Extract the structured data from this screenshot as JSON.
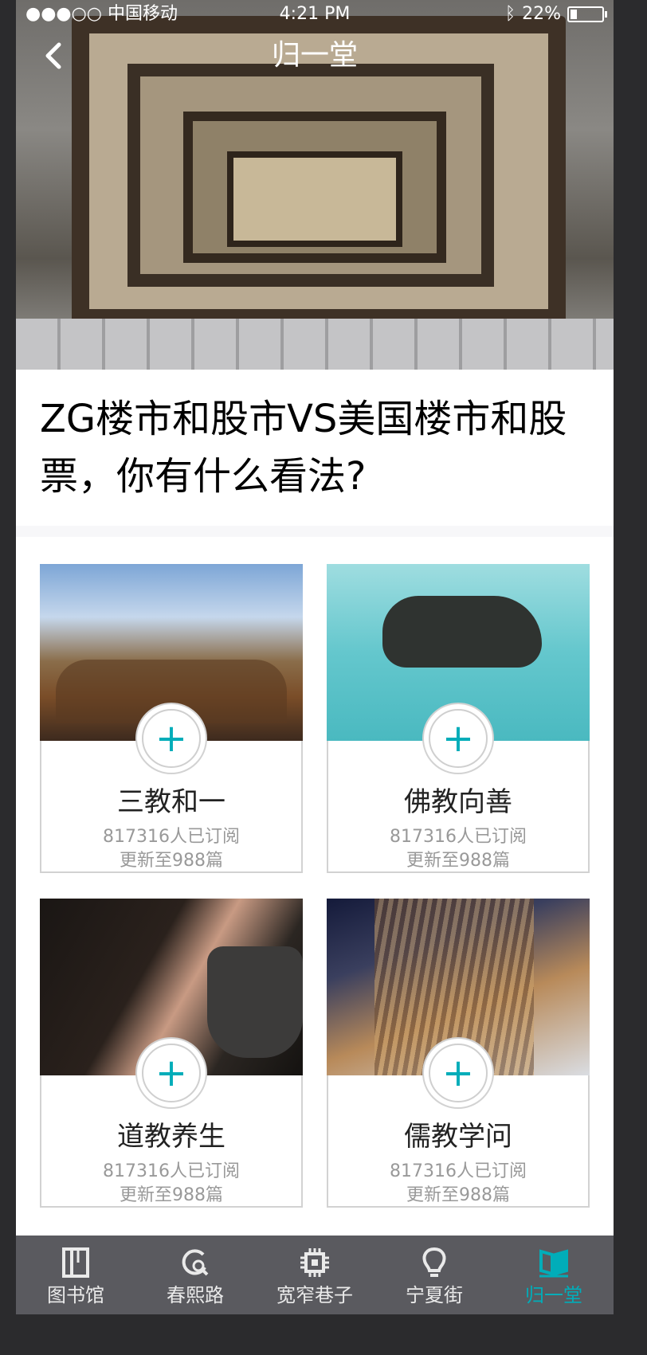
{
  "status_bar": {
    "carrier": "●●●○○ 中国移动",
    "time": "4:21 PM",
    "battery": "22%"
  },
  "nav": {
    "title": "归一堂",
    "back_icon": "chevron-left-icon"
  },
  "headline": "ZG楼市和股市VS美国楼市和股票，你有什么看法?",
  "cards": [
    {
      "title": "三教和一",
      "subscribers": "817316人已订阅",
      "updates": "更新至988篇",
      "add_icon": "plus-icon"
    },
    {
      "title": "佛教向善",
      "subscribers": "817316人已订阅",
      "updates": "更新至988篇",
      "add_icon": "plus-icon"
    },
    {
      "title": "道教养生",
      "subscribers": "817316人已订阅",
      "updates": "更新至988篇",
      "add_icon": "plus-icon"
    },
    {
      "title": "儒教学问",
      "subscribers": "817316人已订阅",
      "updates": "更新至988篇",
      "add_icon": "plus-icon"
    }
  ],
  "tab_bar": {
    "items": [
      {
        "label": "图书馆",
        "icon": "library-icon"
      },
      {
        "label": "春熙路",
        "icon": "refresh-search-icon"
      },
      {
        "label": "宽窄巷子",
        "icon": "chip-icon"
      },
      {
        "label": "宁夏街",
        "icon": "lightbulb-icon"
      },
      {
        "label": "归一堂",
        "icon": "open-book-icon"
      }
    ],
    "active_index": 4
  },
  "colors": {
    "accent": "#01adb9",
    "headline": "#000000",
    "separator": "#f7f7f9",
    "card_border": "#d2d2d2",
    "subtext": "#999999",
    "tab_bar_bg": "#5a5a5f"
  }
}
